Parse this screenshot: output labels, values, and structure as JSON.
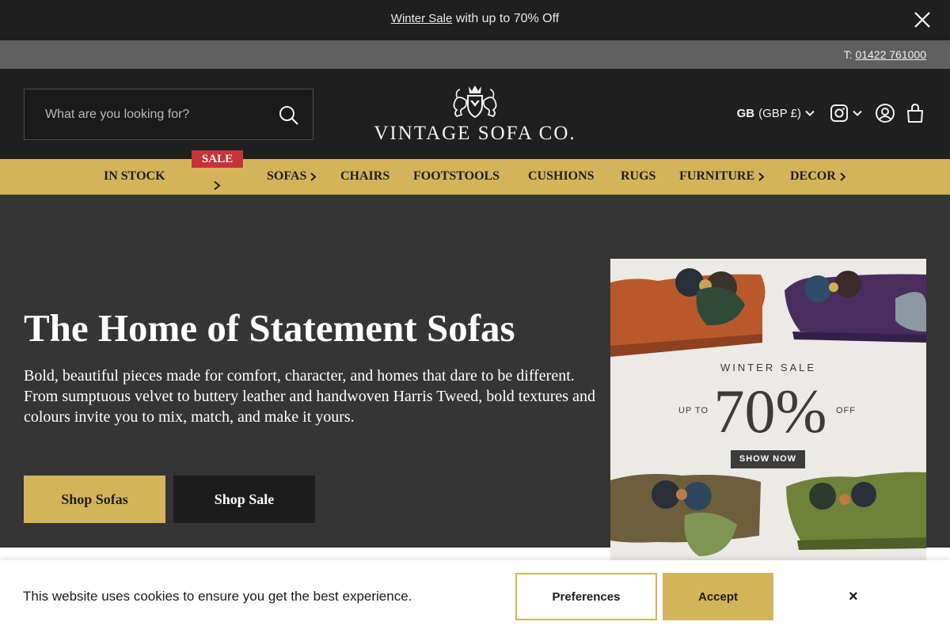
{
  "announcement": {
    "link_text": "Winter Sale",
    "text": " with up to 70% Off",
    "close_icon": "close-icon"
  },
  "contact": {
    "prefix": "T: ",
    "phone": "01422 761000"
  },
  "header": {
    "search_placeholder": "What are you looking for?",
    "logo_text": "VINTAGE SOFA CO.",
    "currency_country": "GB",
    "currency_code": "(GBP £)",
    "icons": [
      "search-icon",
      "crest-logo",
      "chevron-down-icon",
      "instagram-icon",
      "account-icon",
      "bag-icon"
    ]
  },
  "nav": {
    "in_stock": "IN STOCK",
    "sale": "SALE",
    "sofas": "SOFAS",
    "chairs": "CHAIRS",
    "footstools": "FOOTSTOOLS",
    "cushions": "CUSHIONS",
    "rugs": "RUGS",
    "furniture": "FURNITURE",
    "decor": "DECOR"
  },
  "hero": {
    "title": "The Home of Statement Sofas",
    "description": "Bold, beautiful pieces made for comfort, character, and homes that dare to be different. From sumptuous velvet to buttery leather and handwoven Harris Tweed, bold textures and colours invite you to mix, match, and make it yours.",
    "primary_button": "Shop Sofas",
    "secondary_button": "Shop Sale"
  },
  "promo": {
    "heading": "WINTER SALE",
    "up_to": "UP TO",
    "percent": "70%",
    "off": "OFF",
    "cta": "SHOW NOW"
  },
  "cookie": {
    "message": "This website uses cookies to ensure you get the best experience.",
    "preferences": "Preferences",
    "accept": "Accept",
    "close": "×"
  },
  "colors": {
    "gold": "#d4b45a",
    "dark": "#1f1f1f",
    "hero_bg": "#353535",
    "sale_red": "#c8323a"
  }
}
